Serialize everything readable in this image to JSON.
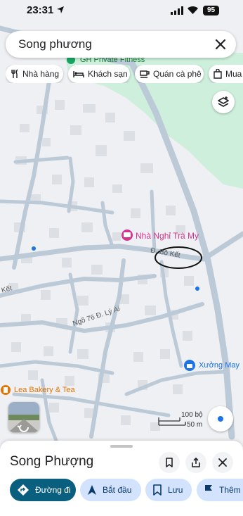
{
  "status_bar": {
    "time": "23:31",
    "battery": "95"
  },
  "search": {
    "query": "Song phương"
  },
  "chips": [
    {
      "label": "Nhà hàng",
      "icon": "restaurant-icon"
    },
    {
      "label": "Khách sạn",
      "icon": "hotel-icon"
    },
    {
      "label": "Quán cà phê",
      "icon": "cafe-icon"
    },
    {
      "label": "Mua",
      "icon": "shopping-icon"
    }
  ],
  "map": {
    "pois": {
      "gym": "GH Private Fitness",
      "hotel": "Nhà Nghỉ Trà My",
      "bakery": "Lea Bakery & Tea",
      "workshop": "Xưởng May"
    },
    "roads": {
      "bo_ket": "Đ. Bồ Kết",
      "ngo76": "Ngõ 76 Đ. Lý Ái",
      "ket": "Kết"
    },
    "scale": {
      "imperial": "100 bộ",
      "metric": "50 m"
    },
    "colors": {
      "land": "#eef0f3",
      "park": "#cdefdc",
      "road": "#bccad8",
      "poi_pink": "#d6338e",
      "poi_blue": "#1a73e8",
      "poi_orange": "#e37400"
    }
  },
  "sheet": {
    "title": "Song Phượng"
  },
  "actions": [
    {
      "label": "Đường đi",
      "icon": "directions-icon"
    },
    {
      "label": "Bắt đầu",
      "icon": "navigation-arrow-icon"
    },
    {
      "label": "Lưu",
      "icon": "bookmark-icon"
    },
    {
      "label": "Thêm",
      "icon": "flag-icon"
    }
  ]
}
